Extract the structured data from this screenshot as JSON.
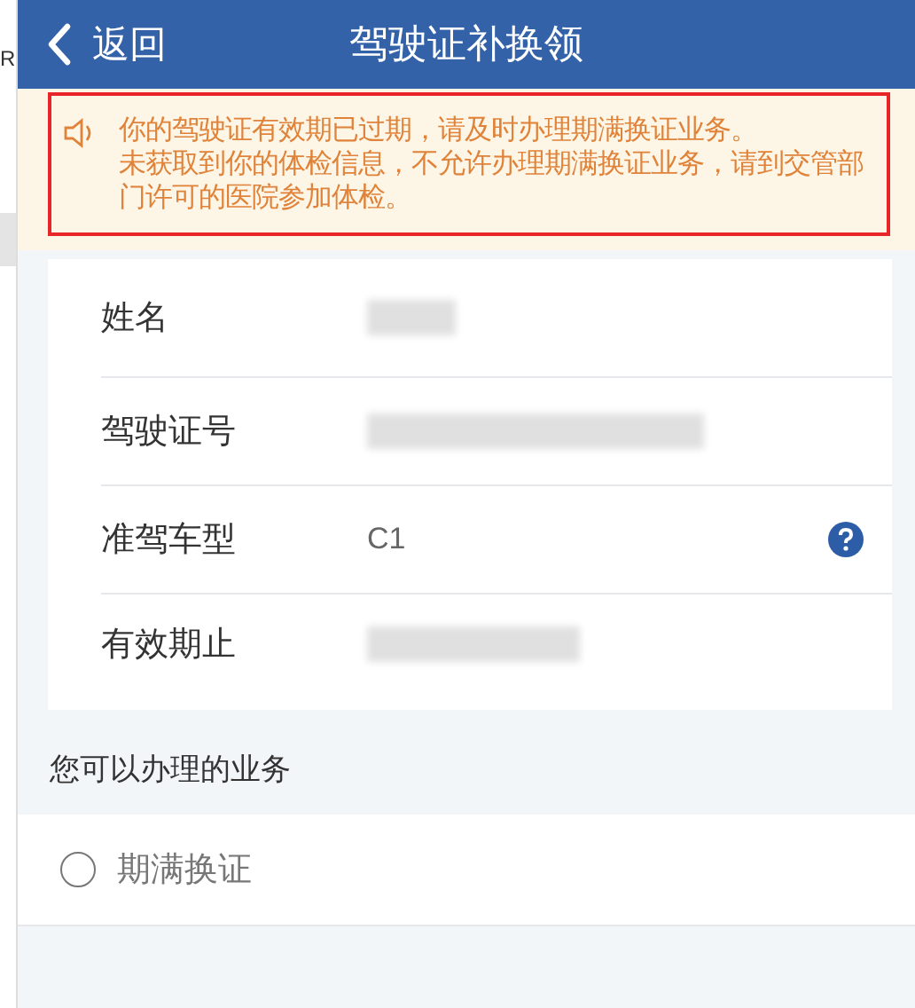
{
  "background_window": {
    "text": "R"
  },
  "header": {
    "back_label": "返回",
    "title": "驾驶证补换领"
  },
  "notice": {
    "highlighted": true,
    "messages": [
      "你的驾驶证有效期已过期，请及时办理期满换证业务。",
      "未获取到你的体检信息，不允许办理期满换证业务，请到交管部门许可的医院参加体检。"
    ]
  },
  "info_rows": [
    {
      "label": "姓名",
      "redacted": true
    },
    {
      "label": "驾驶证号",
      "redacted": true
    },
    {
      "label": "准驾车型",
      "value": "C1",
      "redacted": false,
      "help": true
    },
    {
      "label": "有效期止",
      "redacted": true
    }
  ],
  "services": {
    "title": "您可以办理的业务",
    "options": [
      {
        "label": "期满换证",
        "selected": false
      }
    ]
  }
}
